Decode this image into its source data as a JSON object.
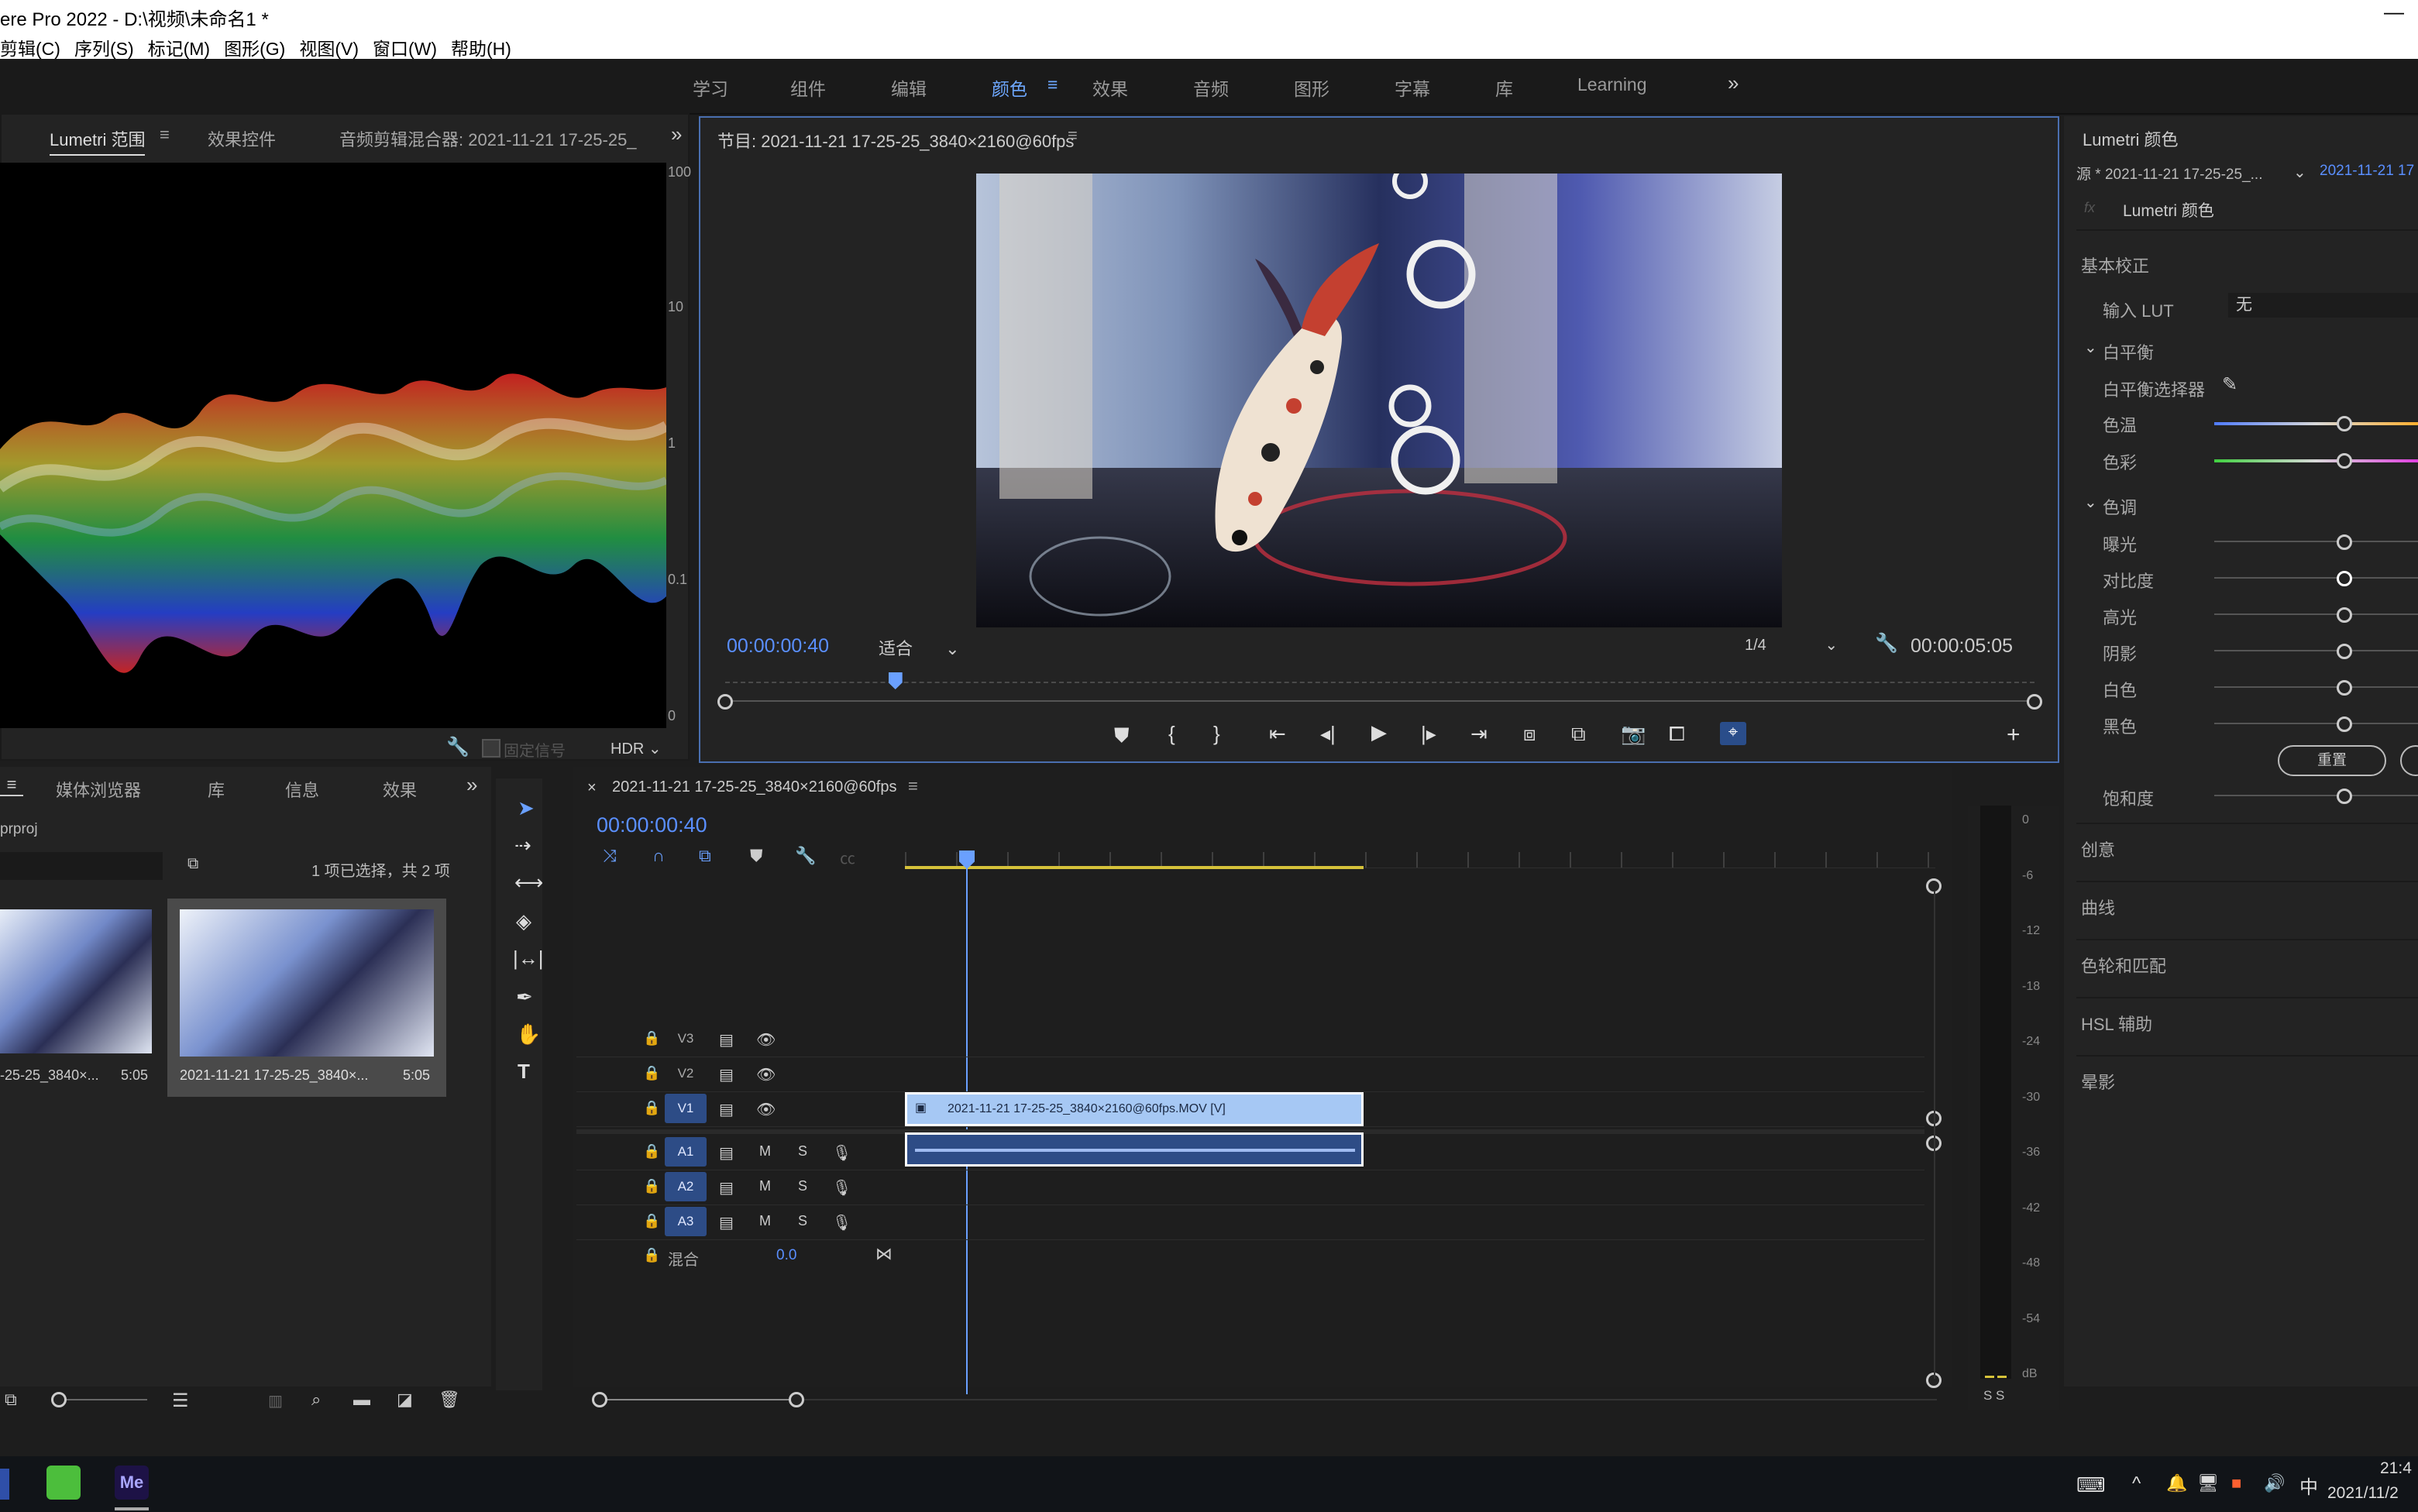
{
  "window_title": "ere Pro 2022 - D:\\视频\\未命名1 *",
  "menu": [
    "剪辑(C)",
    "序列(S)",
    "标记(M)",
    "图形(G)",
    "视图(V)",
    "窗口(W)",
    "帮助(H)"
  ],
  "workspaces": {
    "items": [
      "学习",
      "组件",
      "编辑",
      "颜色",
      "效果",
      "音频",
      "图形",
      "字幕",
      "库",
      "Learning"
    ],
    "active": "颜色",
    "overflow": "»"
  },
  "left_panel": {
    "tabs": [
      "Lumetri 范围",
      "效果控件",
      "音频剪辑混合器: 2021-11-21 17-25-25_"
    ],
    "scale_labels": [
      "100",
      "10",
      "1",
      "0.1",
      "0"
    ],
    "clamp_label": "固定信号",
    "mode": "HDR"
  },
  "program": {
    "title": "节目: 2021-11-21 17-25-25_3840×2160@60fps",
    "current_time": "00:00:00:40",
    "fit": "适合",
    "resolution": "1/4",
    "duration": "00:00:05:05",
    "playhead_fraction": 0.13
  },
  "lumetri": {
    "title": "Lumetri 颜色",
    "source": "源 * 2021-11-21 17-25-25_...",
    "source_right": "2021-11-21 17",
    "effect": "Lumetri 颜色",
    "section_basic": "基本校正",
    "input_lut_label": "输入 LUT",
    "input_lut_value": "无",
    "white_balance": "白平衡",
    "wb_picker": "白平衡选择器",
    "temp_label": "色温",
    "tint_label": "色彩",
    "tone": "色调",
    "tone_rows": [
      "曝光",
      "对比度",
      "高光",
      "阴影",
      "白色",
      "黑色"
    ],
    "reset": "重置",
    "saturation": "饱和度",
    "sections": [
      "创意",
      "曲线",
      "色轮和匹配",
      "HSL 辅助",
      "晕影"
    ]
  },
  "project": {
    "tabs": [
      "媒体浏览器",
      "库",
      "信息",
      "效果"
    ],
    "file": "prproj",
    "selection_info": "1 项已选择，共 2 项",
    "items": [
      {
        "name": "-25-25_3840×...",
        "duration": "5:05"
      },
      {
        "name": "2021-11-21 17-25-25_3840×...",
        "duration": "5:05"
      }
    ]
  },
  "timeline": {
    "tab": "2021-11-21 17-25-25_3840×2160@60fps",
    "timecode": "00:00:00:40",
    "video_tracks": [
      "V3",
      "V2",
      "V1"
    ],
    "audio_tracks": [
      "A1",
      "A2",
      "A3"
    ],
    "mix_label": "混合",
    "mix_value": "0.0",
    "clip_label": "2021-11-21 17-25-25_3840×2160@60fps.MOV [V]",
    "m_label": "M",
    "s_label": "S"
  },
  "meter": {
    "ticks": [
      "0",
      "-6",
      "-12",
      "-18",
      "-24",
      "-30",
      "-36",
      "-42",
      "-48",
      "-54",
      "dB"
    ],
    "solo": "S  S"
  },
  "taskbar": {
    "ime": "中",
    "time": "21:4",
    "date": "2021/11/2"
  }
}
